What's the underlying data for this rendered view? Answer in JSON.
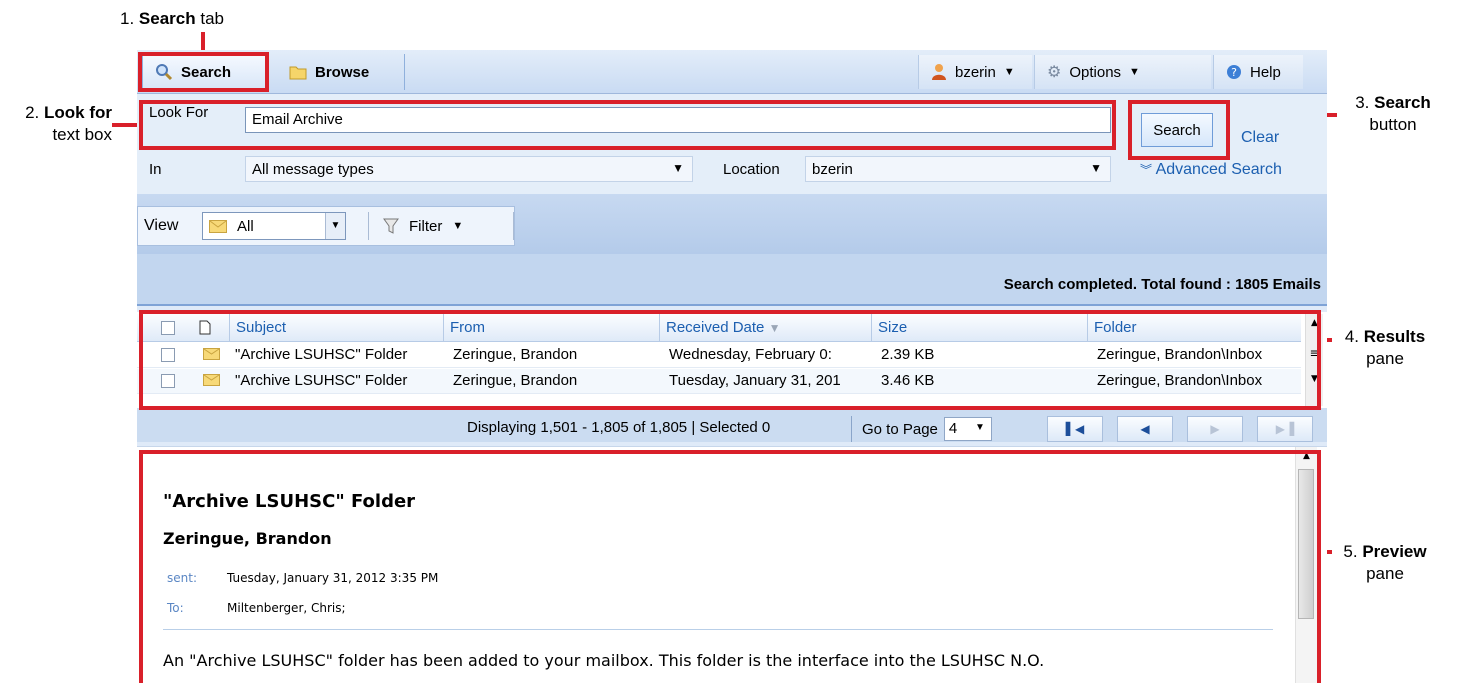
{
  "annotations": {
    "a1_num": "1.",
    "a1_bold": "Search",
    "a1_rest": " tab",
    "a2_num": "2.",
    "a2_bold": "Look for",
    "a2_rest": "text box",
    "a3_num": "3.",
    "a3_bold": "Search",
    "a3_rest": "button",
    "a4_num": "4.",
    "a4_bold": "Results",
    "a4_rest": "pane",
    "a5_num": "5.",
    "a5_bold": "Preview",
    "a5_rest": "pane"
  },
  "tabs": {
    "search": "Search",
    "browse": "Browse"
  },
  "toolbar": {
    "user": "bzerin",
    "options": "Options",
    "help": "Help"
  },
  "search_form": {
    "look_for_label": "Look For",
    "look_for_value": "Email Archive",
    "in_label": "In",
    "message_types": "All message types",
    "location_label": "Location",
    "location_value": "bzerin",
    "search_button": "Search",
    "clear_link": "Clear",
    "advanced_link": "Advanced Search"
  },
  "view_bar": {
    "view_label": "View",
    "view_value": "All",
    "filter_label": "Filter"
  },
  "status": "Search completed. Total found : 1805 Emails",
  "results": {
    "columns": [
      "Subject",
      "From",
      "Received Date",
      "Size",
      "Folder"
    ],
    "rows": [
      {
        "subject": "\"Archive LSUHSC\" Folder",
        "from": "Zeringue, Brandon",
        "date": "Wednesday, February 0:",
        "size": "2.39 KB",
        "folder": "Zeringue, Brandon\\Inbox"
      },
      {
        "subject": "\"Archive LSUHSC\" Folder",
        "from": "Zeringue, Brandon",
        "date": "Tuesday, January 31, 201",
        "size": "3.46 KB",
        "folder": "Zeringue, Brandon\\Inbox"
      }
    ]
  },
  "pager": {
    "info": "Displaying 1,501 - 1,805 of 1,805 | Selected 0",
    "goto_label": "Go to Page",
    "page": "4"
  },
  "preview": {
    "title": "\"Archive LSUHSC\" Folder",
    "from": "Zeringue, Brandon",
    "sent_label": "sent:",
    "sent_value": "Tuesday, January 31, 2012 3:35 PM",
    "to_label": "To:",
    "to_value": "Miltenberger, Chris;",
    "body": "An \"Archive LSUHSC\" folder has been added to your mailbox.  This folder is the interface into the LSUHSC N.O."
  },
  "colors": {
    "accent": "#d9202a",
    "link": "#1c5fb0",
    "chrome": "#c2d6ef"
  }
}
